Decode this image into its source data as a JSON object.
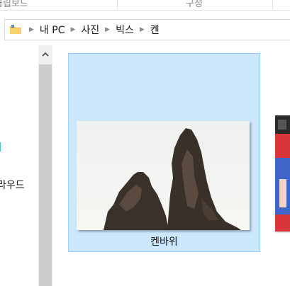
{
  "ribbon": {
    "group_left": "클립보드",
    "group_right": "구성"
  },
  "address_bar": {
    "icon": "folder-icon",
    "crumbs": [
      "내 PC",
      "사진",
      "빅스",
      "켄"
    ]
  },
  "navigation": {
    "partial_item_label": "라우드",
    "scroll_up_icon": "chevron-up-icon"
  },
  "items": [
    {
      "name": "켄바위",
      "selected": true
    }
  ],
  "colors": {
    "selection_fill": "#cce8ff",
    "selection_border": "#99d1ff",
    "accent_teal": "#3fc1c0"
  }
}
